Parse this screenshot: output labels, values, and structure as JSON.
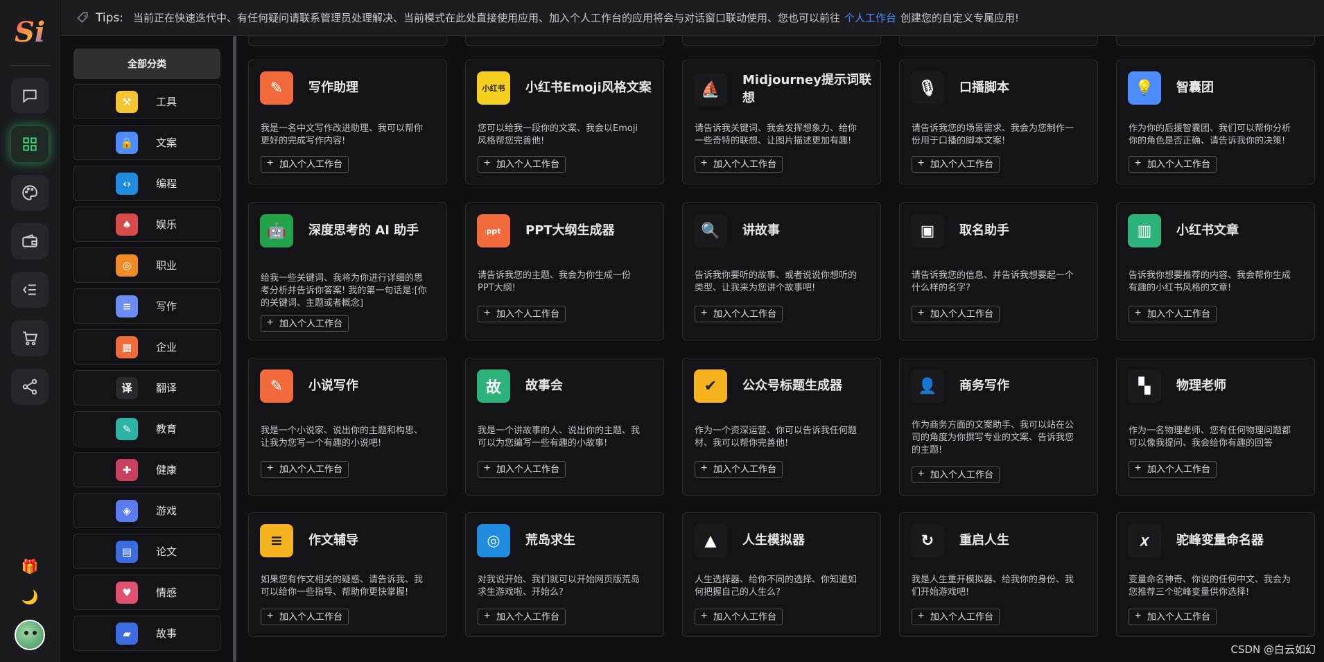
{
  "logo_text": "Si",
  "tips": {
    "label": "Tips:",
    "text_before": "当前正在快速迭代中、有任何疑问请联系管理员处理解决、当前模式在此处直接使用应用、加入个人工作台的应用将会与对话窗口联动使用、您也可以前往",
    "link": "个人工作台",
    "text_after": "创建您的自定义专属应用!"
  },
  "rail": {
    "icons": [
      "chat-icon",
      "grid-icon",
      "palette-icon",
      "wallet-icon",
      "menu-list-icon",
      "cart-icon",
      "share-icon"
    ],
    "active": "grid-icon",
    "bottom": [
      "gift-icon",
      "moon-icon"
    ]
  },
  "categories": {
    "all_label": "全部分类",
    "items": [
      {
        "label": "工具",
        "icon": "toolbox-icon",
        "color": "#f5c431",
        "glyph": "⚒"
      },
      {
        "label": "文案",
        "icon": "lock-icon",
        "color": "#4f8cff",
        "glyph": "🔒"
      },
      {
        "label": "编程",
        "icon": "code-icon",
        "color": "#1f8ce0",
        "glyph": "‹›"
      },
      {
        "label": "娱乐",
        "icon": "poker-icon",
        "color": "#d94c4c",
        "glyph": "♠"
      },
      {
        "label": "职业",
        "icon": "career-icon",
        "color": "#f08a24",
        "glyph": "◎"
      },
      {
        "label": "写作",
        "icon": "notepad-icon",
        "color": "#6b8df5",
        "glyph": "≡"
      },
      {
        "label": "企业",
        "icon": "building-icon",
        "color": "#f06a3c",
        "glyph": "▦"
      },
      {
        "label": "翻译",
        "icon": "translate-icon",
        "color": "#2a2a2e",
        "glyph": "译"
      },
      {
        "label": "教育",
        "icon": "education-icon",
        "color": "#2db3a6",
        "glyph": "✎"
      },
      {
        "label": "健康",
        "icon": "health-icon",
        "color": "#c94060",
        "glyph": "✚"
      },
      {
        "label": "游戏",
        "icon": "gamepad-icon",
        "color": "#5b7cf0",
        "glyph": "◈"
      },
      {
        "label": "论文",
        "icon": "document-icon",
        "color": "#3d6be0",
        "glyph": "▤"
      },
      {
        "label": "情感",
        "icon": "hearts-icon",
        "color": "#e0506f",
        "glyph": "♥"
      },
      {
        "label": "故事",
        "icon": "book-icon",
        "color": "#3d6be0",
        "glyph": "▰"
      }
    ]
  },
  "add_label": "加入个人工作台",
  "cards": [
    {
      "title": "写作助理",
      "icon": "pen-icon",
      "color": "#f06a3c",
      "glyph": "✎",
      "desc": "我是一名中文写作改进助理、我可以帮你更好的完成写作内容!"
    },
    {
      "title": "小红书Emoji风格文案",
      "icon": "xiaohongshu-icon",
      "color": "#f5d020",
      "glyph": "小红书",
      "desc": "您可以给我一段你的文案、我会以Emoji风格帮您完善他!"
    },
    {
      "title": "Midjourney提示词联想",
      "icon": "sailboat-icon",
      "color": "#1a1a1e",
      "glyph": "⛵",
      "desc": "请告诉我关键词、我会发挥想象力、给你一些奇特的联想、让图片描述更加有趣!"
    },
    {
      "title": "口播脚本",
      "icon": "microphone-icon",
      "color": "#1a1a1e",
      "glyph": "🎙",
      "desc": "请告诉我您的场景需求、我会为您制作一份用于口播的脚本文案!"
    },
    {
      "title": "智囊团",
      "icon": "lightbulb-icon",
      "color": "#4f8cff",
      "glyph": "💡",
      "desc": "作为你的后援智囊团、我们可以帮你分析你的角色是否正确、请告诉我你的决策!"
    },
    {
      "title": "深度思考的 AI 助手",
      "icon": "robot-icon",
      "color": "#22a34a",
      "glyph": "🤖",
      "desc": "给我一些关键词、我将为你进行详细的思考分析并告诉你答案!  我的第一句话是:[你的关键词、主题或者概念]"
    },
    {
      "title": "PPT大纲生成器",
      "icon": "ppt-icon",
      "color": "#f06a3c",
      "glyph": "ppt",
      "desc": "请告诉我您的主题、我会为你生成一份PPT大纲!"
    },
    {
      "title": "讲故事",
      "icon": "magnifier-icon",
      "color": "#1a1a1e",
      "glyph": "🔍",
      "desc": "告诉我你要听的故事、或者说说你想听的类型、让我来为您讲个故事吧!"
    },
    {
      "title": "取名助手",
      "icon": "name-card-icon",
      "color": "#1a1a1e",
      "glyph": "▣",
      "desc": "请告诉我您的信息、并告诉我想要起一个什么样的名字?"
    },
    {
      "title": "小红书文章",
      "icon": "notebook-icon",
      "color": "#2db37a",
      "glyph": "▥",
      "desc": "告诉我你想要推荐的内容、我会帮你生成有趣的小红书风格的文章!"
    },
    {
      "title": "小说写作",
      "icon": "novel-icon",
      "color": "#f06a3c",
      "glyph": "✎",
      "desc": "我是一个小说家、说出你的主题和构思、让我为您写一个有趣的小说吧!"
    },
    {
      "title": "故事会",
      "icon": "story-book-icon",
      "color": "#2db37a",
      "glyph": "故",
      "desc": "我是一个讲故事的人、说出你的主题、我可以为您编写一些有趣的小故事!"
    },
    {
      "title": "公众号标题生成器",
      "icon": "verified-badge-icon",
      "color": "#f5b31f",
      "glyph": "✔",
      "desc": "作为一个资深运营、你可以告诉我任何题材、我可以帮你完善他!"
    },
    {
      "title": "商务写作",
      "icon": "businessman-icon",
      "color": "#1a1a1e",
      "glyph": "👤",
      "desc": "作为商务方面的文案助手、我可以站在公司的角度为你撰写专业的文案、告诉我您的主题!"
    },
    {
      "title": "物理老师",
      "icon": "physics-icon",
      "color": "#1a1a1e",
      "glyph": "▚",
      "desc": "作为一名物理老师、您有任何物理问题都可以像我提问、我会给你有趣的回答"
    },
    {
      "title": "作文辅导",
      "icon": "essay-icon",
      "color": "#f5b31f",
      "glyph": "≡",
      "desc": "如果您有作文相关的疑惑、请告诉我、我可以给你一些指导、帮助你更快掌握!"
    },
    {
      "title": "荒岛求生",
      "icon": "lifebuoy-icon",
      "color": "#1f8ce0",
      "glyph": "◎",
      "desc": "对我说开始、我们就可以开始网页版荒岛求生游戏啦、开始么?"
    },
    {
      "title": "人生模拟器",
      "icon": "lighthouse-icon",
      "color": "#1a1a1e",
      "glyph": "▲",
      "desc": "人生选择器、给你不同的选择、你知道如何把握自己的人生么?"
    },
    {
      "title": "重启人生",
      "icon": "restart-icon",
      "color": "#1a1a1e",
      "glyph": "↻",
      "desc": "我是人生重开模拟器、给我你的身份、我们开始游戏吧!"
    },
    {
      "title": "驼峰变量命名器",
      "icon": "variable-x-icon",
      "color": "#1a1a1e",
      "glyph": "𝑥",
      "desc": "变量命名神奇、你说的任何中文、我会为您推荐三个驼峰变量供你选择!"
    }
  ],
  "watermark": "CSDN @白云如幻"
}
